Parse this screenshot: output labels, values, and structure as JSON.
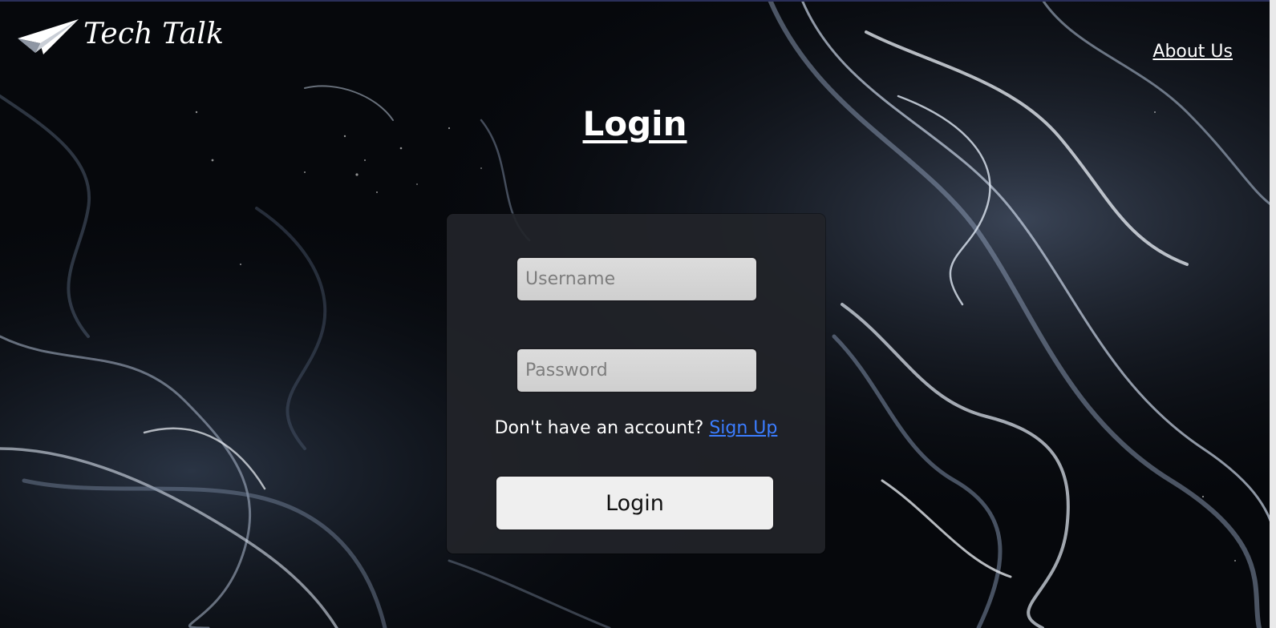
{
  "header": {
    "brand_name": "Tech Talk",
    "logo_icon": "paper-plane-icon",
    "nav": {
      "about_label": "About Us"
    }
  },
  "main": {
    "title": "Login",
    "form": {
      "username_placeholder": "Username",
      "username_value": "",
      "password_placeholder": "Password",
      "password_value": "",
      "signup_prompt": "Don't have an account?",
      "signup_link_label": "Sign Up",
      "submit_label": "Login"
    }
  },
  "colors": {
    "link": "#3b7dff",
    "card_background": "#222429",
    "page_background": "#05070b"
  }
}
